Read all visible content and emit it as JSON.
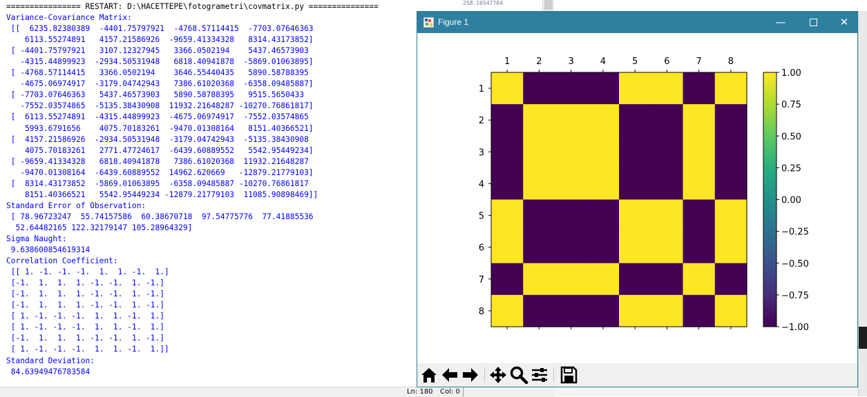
{
  "shell": {
    "lines": [
      "================ RESTART: D:\\HACETTEPE\\fotogrametri\\covmatrix.py ===============",
      "Variance-Covariance Matrix:",
      " [[  6235.82380389  -4401.75797921  -4768.57114415  -7703.07646363",
      "    6113.55274891   4157.21586926  -9659.41334328   8314.43173852]",
      " [ -4401.75797921   3107.12327945   3366.0502194    5437.46573903",
      "   -4315.44899923  -2934.50531948   6818.40941878  -5869.01063895]",
      " [ -4768.57114415   3366.0502194    3646.55440435   5890.58788395",
      "   -4675.06974917  -3179.04742943   7386.61020368  -6358.09485887]",
      " [ -7703.07646363   5437.46573903   5890.58788395   9515.5650433",
      "   -7552.03574865  -5135.38430908  11932.21648287 -10270.76861817]",
      " [  6113.55274891  -4315.44899923  -4675.06974917  -7552.03574865",
      "    5993.6791656    4075.70183261  -9470.01308164   8151.40366521]",
      " [  4157.21586926  -2934.50531948  -3179.04742943  -5135.38430908",
      "    4075.70183261   2771.47724617  -6439.60889552   5542.95449234]",
      " [ -9659.41334328   6818.40941878   7386.61020368  11932.21648287",
      "   -9470.01308164  -6439.60889552  14962.620669   -12879.21779103]",
      " [  8314.43173852  -5869.01063895  -6358.09485887 -10270.76861817",
      "    8151.40366521   5542.95449234 -12879.21779103  11085.90898469]]",
      "Standard Error of Observation:",
      " [ 78.96723247  55.74157586  60.38670718  97.54775776  77.41885536",
      "  52.64482165 122.32179147 105.28964329]",
      "Sigma Naught:",
      " 9.638600854619314",
      "Correlation Coefficient:",
      " [[ 1. -1. -1. -1.  1.  1. -1.  1.]",
      " [-1.  1.  1.  1. -1. -1.  1. -1.]",
      " [-1.  1.  1.  1. -1. -1.  1. -1.]",
      " [-1.  1.  1.  1. -1. -1.  1. -1.]",
      " [ 1. -1. -1. -1.  1.  1. -1.  1.]",
      " [ 1. -1. -1. -1.  1.  1. -1.  1.]",
      " [-1.  1.  1.  1. -1. -1.  1. -1.]",
      " [ 1. -1. -1. -1.  1.  1. -1.  1.]]",
      "Standard Deviation:",
      " 84.63949476783584"
    ],
    "text_color": "#0000ff"
  },
  "status": {
    "ln": "Ln: 180",
    "col": "Col: 0"
  },
  "background_app": {
    "coordinate_text": "258.16547704"
  },
  "figure": {
    "title": "Figure 1",
    "controls": {
      "minimize": "—",
      "close": "✕"
    },
    "toolbar": {
      "icons": [
        "home-icon",
        "back-icon",
        "forward-icon",
        "pan-icon",
        "zoom-icon",
        "configure-subplots-icon",
        "save-icon"
      ]
    }
  },
  "chart_data": {
    "type": "heatmap",
    "x_tick_labels": [
      "1",
      "2",
      "3",
      "4",
      "5",
      "6",
      "7",
      "8"
    ],
    "y_tick_labels": [
      "1",
      "2",
      "3",
      "4",
      "5",
      "6",
      "7",
      "8"
    ],
    "x_ticks_position": "top",
    "matrix": [
      [
        1,
        -1,
        -1,
        -1,
        1,
        1,
        -1,
        1
      ],
      [
        -1,
        1,
        1,
        1,
        -1,
        -1,
        1,
        -1
      ],
      [
        -1,
        1,
        1,
        1,
        -1,
        -1,
        1,
        -1
      ],
      [
        -1,
        1,
        1,
        1,
        -1,
        -1,
        1,
        -1
      ],
      [
        1,
        -1,
        -1,
        -1,
        1,
        1,
        -1,
        1
      ],
      [
        1,
        -1,
        -1,
        -1,
        1,
        1,
        -1,
        1
      ],
      [
        -1,
        1,
        1,
        1,
        -1,
        -1,
        1,
        -1
      ],
      [
        1,
        -1,
        -1,
        -1,
        1,
        1,
        -1,
        1
      ]
    ],
    "colormap": "viridis",
    "color_low": "#440154",
    "color_high": "#fde725",
    "clim": [
      -1.0,
      1.0
    ],
    "colorbar_ticks": [
      1.0,
      0.75,
      0.5,
      0.25,
      0.0,
      -0.25,
      -0.5,
      -0.75,
      -1.0
    ],
    "colorbar_tick_labels": [
      "1.00",
      "0.75",
      "0.50",
      "0.25",
      "0.00",
      "−0.25",
      "−0.50",
      "−0.75",
      "−1.00"
    ],
    "colorbar_position": "right",
    "grid": false
  }
}
